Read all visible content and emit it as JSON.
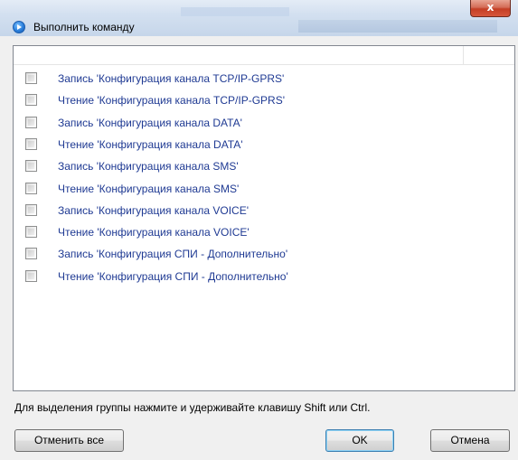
{
  "window": {
    "title": "Выполнить команду",
    "close_glyph": "x"
  },
  "list": {
    "items": [
      {
        "label": "Запись 'Конфигурация канала TCP/IP-GPRS'",
        "checked": false
      },
      {
        "label": "Чтение 'Конфигурация канала TCP/IP-GPRS'",
        "checked": false
      },
      {
        "label": "Запись 'Конфигурация канала DATA'",
        "checked": false
      },
      {
        "label": "Чтение 'Конфигурация канала DATA'",
        "checked": false
      },
      {
        "label": "Запись 'Конфигурация канала SMS'",
        "checked": false
      },
      {
        "label": "Чтение 'Конфигурация канала SMS'",
        "checked": false
      },
      {
        "label": "Запись 'Конфигурация канала VOICE'",
        "checked": false
      },
      {
        "label": "Чтение 'Конфигурация канала VOICE'",
        "checked": false
      },
      {
        "label": "Запись 'Конфигурация СПИ - Дополнительно'",
        "checked": false
      },
      {
        "label": "Чтение 'Конфигурация СПИ - Дополнительно'",
        "checked": false
      }
    ]
  },
  "footer": {
    "hint": "Для выделения группы нажмите и удерживайте клавишу Shift или Ctrl.",
    "deselect_label": "Отменить все",
    "ok_label": "OK",
    "cancel_label": "Отмена"
  },
  "icons": {
    "app": "run-command-icon",
    "close": "close-icon"
  },
  "colors": {
    "item_text": "#1f3a93",
    "close_button": "#c43e24"
  }
}
